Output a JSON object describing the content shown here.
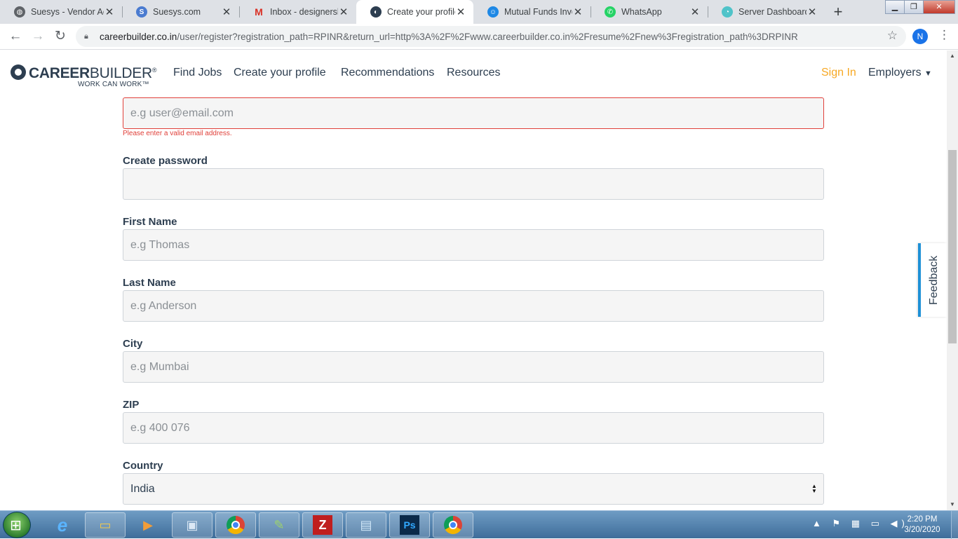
{
  "browser": {
    "tabs": [
      {
        "title": "Suesys - Vendor Ac",
        "icon": "globe-icon",
        "color": "#5f6368"
      },
      {
        "title": "Suesys.com",
        "icon": "suesys-icon",
        "color": "#4a7bd0"
      },
      {
        "title": "Inbox - designersh",
        "icon": "gmail-icon",
        "color": "#d93025"
      },
      {
        "title": "Create your profile",
        "icon": "careerbuilder-icon",
        "color": "#2d3e50"
      },
      {
        "title": "Mutual Funds Inve",
        "icon": "mutual-funds-icon",
        "color": "#1e88e5"
      },
      {
        "title": "WhatsApp",
        "icon": "whatsapp-icon",
        "color": "#25d366"
      },
      {
        "title": "Server Dashboard",
        "icon": "server-dashboard-icon",
        "color": "#4fc3c9"
      }
    ],
    "url_host": "careerbuilder.co.in",
    "url_path": "/user/register?registration_path=RPINR&return_url=http%3A%2F%2Fwww.careerbuilder.co.in%2Fresume%2Fnew%3Fregistration_path%3DRPINR",
    "profile_initial": "N"
  },
  "site": {
    "logo_word_bold": "CAREER",
    "logo_word_light": "BUILDER",
    "logo_reg": "®",
    "logo_tagline": "WORK CAN WORK™",
    "nav": [
      "Find Jobs",
      "Create your profile",
      "Recommendations",
      "Resources"
    ],
    "sign_in": "Sign In",
    "employers": "Employers",
    "accent_color": "#f7a823"
  },
  "form": {
    "email": {
      "placeholder": "e.g user@email.com",
      "value": "",
      "error": "Please enter a valid email address."
    },
    "password": {
      "label": "Create password",
      "placeholder": ""
    },
    "first_name": {
      "label": "First Name",
      "placeholder": "e.g Thomas"
    },
    "last_name": {
      "label": "Last Name",
      "placeholder": "e.g Anderson"
    },
    "city": {
      "label": "City",
      "placeholder": "e.g Mumbai"
    },
    "zip": {
      "label": "ZIP",
      "placeholder": "e.g 400 076"
    },
    "country": {
      "label": "Country",
      "value": "India"
    }
  },
  "feedback_label": "Feedback",
  "taskbar": {
    "time": "2:20 PM",
    "date": "3/20/2020",
    "apps": [
      "internet-explorer-icon",
      "file-explorer-icon",
      "media-player-icon",
      "remote-desktop-icon",
      "chrome-icon",
      "notepad-plus-icon",
      "filezilla-icon",
      "notepad-icon",
      "photoshop-icon",
      "chrome-icon"
    ]
  }
}
